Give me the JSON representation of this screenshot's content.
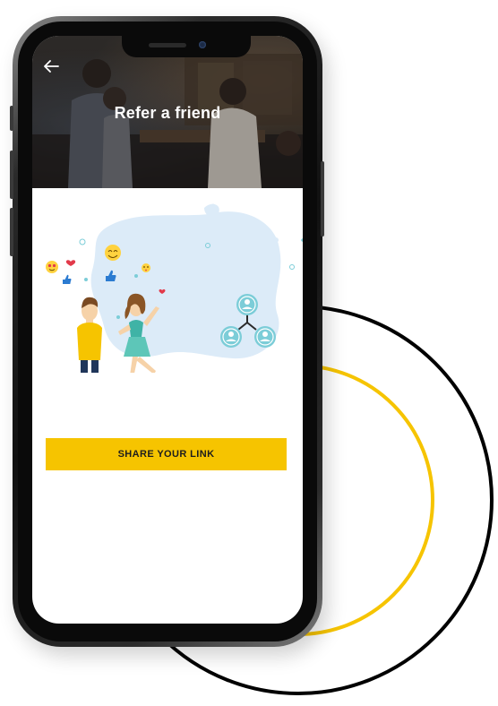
{
  "screen": {
    "title": "Refer a friend",
    "back_icon": "back-arrow-icon",
    "illustration": "friends-referral-illustration"
  },
  "actions": {
    "share_label": "SHARE YOUR LINK"
  },
  "colors": {
    "accent": "#f6c400",
    "ring_outer": "#000000",
    "ring_inner": "#f6c400",
    "blob": "#dcebf8",
    "node": "#7ccdd8"
  }
}
